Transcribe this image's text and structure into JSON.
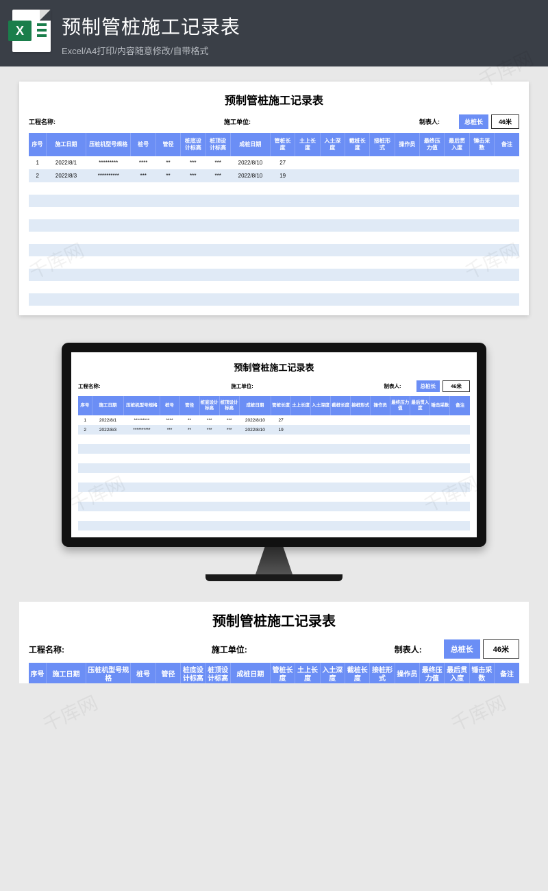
{
  "header": {
    "title": "预制管桩施工记录表",
    "subtitle": "Excel/A4打印/内容随意修改/自带格式",
    "icon_letter": "X"
  },
  "sheet": {
    "title": "预制管桩施工记录表",
    "meta": {
      "project_label": "工程名称:",
      "unit_label": "施工单位:",
      "author_label": "制表人:",
      "total_label": "总桩长",
      "total_value": "46米"
    },
    "columns": [
      "序号",
      "施工日期",
      "压桩机型号规格",
      "桩号",
      "管径",
      "桩底设计标高",
      "桩顶设计标高",
      "成桩日期",
      "管桩长度",
      "土上长度",
      "入土深度",
      "截桩长度",
      "接桩形式",
      "操作员",
      "最终压力值",
      "最后贯入度",
      "锤击采数",
      "备注"
    ],
    "rows": [
      {
        "c": [
          "1",
          "2022/8/1",
          "*********",
          "****",
          "**",
          "***",
          "***",
          "2022/8/10",
          "27",
          "",
          "",
          "",
          "",
          "",
          "",
          "",
          "",
          ""
        ]
      },
      {
        "c": [
          "2",
          "2022/8/3",
          "**********",
          "***",
          "**",
          "***",
          "***",
          "2022/8/10",
          "19",
          "",
          "",
          "",
          "",
          "",
          "",
          "",
          "",
          ""
        ]
      },
      {
        "c": [
          "",
          "",
          "",
          "",
          "",
          "",
          "",
          "",
          "",
          "",
          "",
          "",
          "",
          "",
          "",
          "",
          "",
          ""
        ]
      },
      {
        "c": [
          "",
          "",
          "",
          "",
          "",
          "",
          "",
          "",
          "",
          "",
          "",
          "",
          "",
          "",
          "",
          "",
          "",
          ""
        ]
      },
      {
        "c": [
          "",
          "",
          "",
          "",
          "",
          "",
          "",
          "",
          "",
          "",
          "",
          "",
          "",
          "",
          "",
          "",
          "",
          ""
        ]
      },
      {
        "c": [
          "",
          "",
          "",
          "",
          "",
          "",
          "",
          "",
          "",
          "",
          "",
          "",
          "",
          "",
          "",
          "",
          "",
          ""
        ]
      },
      {
        "c": [
          "",
          "",
          "",
          "",
          "",
          "",
          "",
          "",
          "",
          "",
          "",
          "",
          "",
          "",
          "",
          "",
          "",
          ""
        ]
      },
      {
        "c": [
          "",
          "",
          "",
          "",
          "",
          "",
          "",
          "",
          "",
          "",
          "",
          "",
          "",
          "",
          "",
          "",
          "",
          ""
        ]
      },
      {
        "c": [
          "",
          "",
          "",
          "",
          "",
          "",
          "",
          "",
          "",
          "",
          "",
          "",
          "",
          "",
          "",
          "",
          "",
          ""
        ]
      },
      {
        "c": [
          "",
          "",
          "",
          "",
          "",
          "",
          "",
          "",
          "",
          "",
          "",
          "",
          "",
          "",
          "",
          "",
          "",
          ""
        ]
      },
      {
        "c": [
          "",
          "",
          "",
          "",
          "",
          "",
          "",
          "",
          "",
          "",
          "",
          "",
          "",
          "",
          "",
          "",
          "",
          ""
        ]
      },
      {
        "c": [
          "",
          "",
          "",
          "",
          "",
          "",
          "",
          "",
          "",
          "",
          "",
          "",
          "",
          "",
          "",
          "",
          "",
          ""
        ]
      }
    ]
  },
  "watermark_text": "千库网"
}
